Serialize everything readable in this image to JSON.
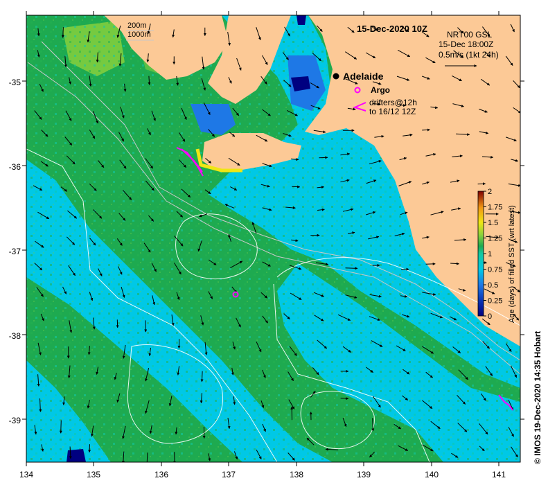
{
  "map": {
    "date_title": "15-Dec-2020 10Z",
    "product_line1": "NRT00 GSL",
    "product_line2": "15-Dec 18:00Z",
    "vector_scale": "0.5m/s (1kt 24h)",
    "city": "Adelaide",
    "legend_argo": "Argo",
    "legend_drifters_1": "drifters@12h",
    "legend_drifters_2": "to 16/12 12Z",
    "contour_200": "200m",
    "contour_1000": "1000m",
    "credit": "© IMOS 19-Dec-2020 14:35 Hobart",
    "x_ticks": [
      "134",
      "135",
      "136",
      "137",
      "138",
      "139",
      "140",
      "141"
    ],
    "y_ticks": [
      "-35",
      "-36",
      "-37",
      "-38",
      "-39"
    ]
  },
  "colorbar": {
    "title": "Age (days) of filled SST (wrt latest)",
    "ticks": [
      "2",
      "1.75",
      "1.5",
      "1.25",
      "1",
      "0.75",
      "0.5",
      "0.25",
      "0"
    ],
    "range": [
      0,
      2
    ]
  },
  "colors": {
    "land": "#fcc996",
    "age_00": "#000080",
    "age_025": "#1e64d8",
    "age_05": "#00c8e6",
    "age_075": "#14c8a0",
    "age_10": "#1eaa50",
    "age_125": "#8cd23c",
    "age_15": "#f0e614",
    "age_175": "#f09614",
    "age_20": "#800000",
    "argo": "#ff00ff",
    "drifter": "#ff00ff"
  }
}
